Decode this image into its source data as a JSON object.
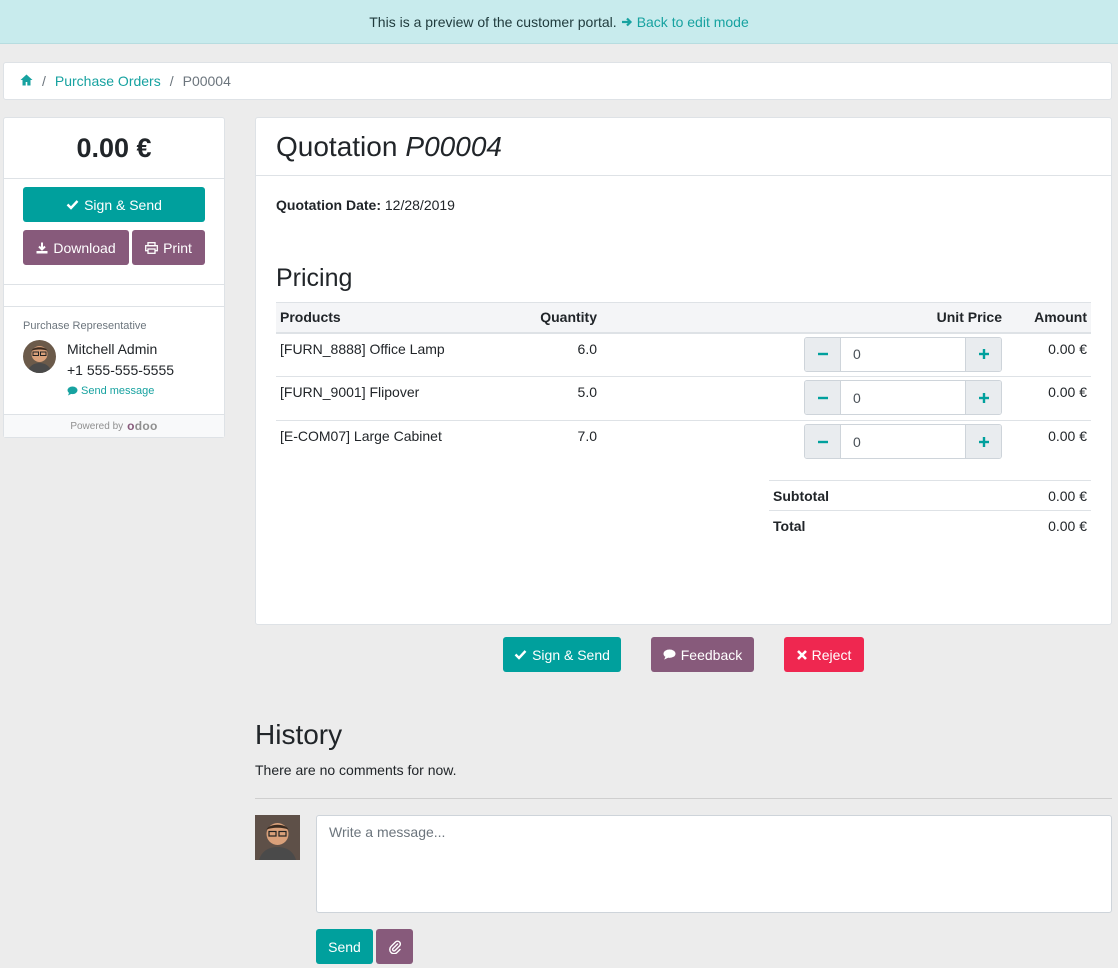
{
  "banner": {
    "text": "This is a preview of the customer portal.",
    "link": "Back to edit mode"
  },
  "breadcrumb": {
    "home_icon": "home-icon",
    "section": "Purchase Orders",
    "current": "P00004"
  },
  "sidebar": {
    "amount": "0.00 €",
    "sign_label": "Sign & Send",
    "download_label": "Download",
    "print_label": "Print",
    "rep_label": "Purchase Representative",
    "rep_name": "Mitchell Admin",
    "rep_phone": "+1 555-555-5555",
    "send_message": "Send message",
    "powered_by": "Powered by",
    "powered_brand": "odoo"
  },
  "quotation": {
    "title": "Quotation",
    "reference": "P00004",
    "date_label": "Quotation Date:",
    "date_value": "12/28/2019",
    "pricing_title": "Pricing"
  },
  "lines": {
    "headers": {
      "products": "Products",
      "quantity": "Quantity",
      "unit_price": "Unit Price",
      "amount": "Amount"
    },
    "rows": [
      {
        "product": "[FURN_8888] Office Lamp",
        "quantity": "6.0",
        "unit_price": "0",
        "amount": "0.00 €"
      },
      {
        "product": "[FURN_9001] Flipover",
        "quantity": "5.0",
        "unit_price": "0",
        "amount": "0.00 €"
      },
      {
        "product": "[E-COM07] Large Cabinet",
        "quantity": "7.0",
        "unit_price": "0",
        "amount": "0.00 €"
      }
    ]
  },
  "totals": {
    "subtotal_label": "Subtotal",
    "subtotal_value": "0.00 €",
    "total_label": "Total",
    "total_value": "0.00 €"
  },
  "actions": {
    "sign_label": "Sign & Send",
    "feedback_label": "Feedback",
    "reject_label": "Reject"
  },
  "history": {
    "title": "History",
    "empty": "There are no comments for now.",
    "placeholder": "Write a message...",
    "send_label": "Send"
  },
  "colors": {
    "primary": "#00a09d",
    "secondary": "#875a7b",
    "danger": "#ef2750",
    "banner": "#c8ebed"
  }
}
